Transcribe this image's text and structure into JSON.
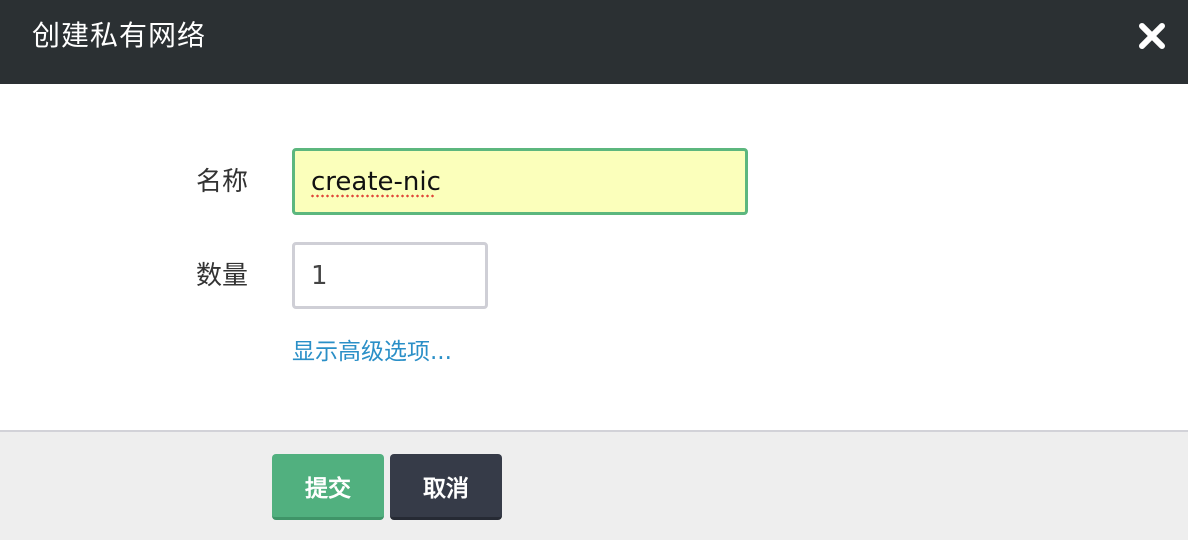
{
  "dialog": {
    "title": "创建私有网络",
    "close_icon": "close-icon"
  },
  "form": {
    "name_label": "名称",
    "name_value": "create-nic",
    "count_label": "数量",
    "count_value": "1",
    "advanced_link": "显示高级选项..."
  },
  "footer": {
    "submit_label": "提交",
    "cancel_label": "取消"
  },
  "colors": {
    "header_bg": "#2b3033",
    "name_field_bg": "#fbffbb",
    "name_field_border": "#5cb77e",
    "link": "#2a8fc7",
    "submit_bg": "#51b07f",
    "cancel_bg": "#363b48",
    "footer_bg": "#eeeeee"
  }
}
